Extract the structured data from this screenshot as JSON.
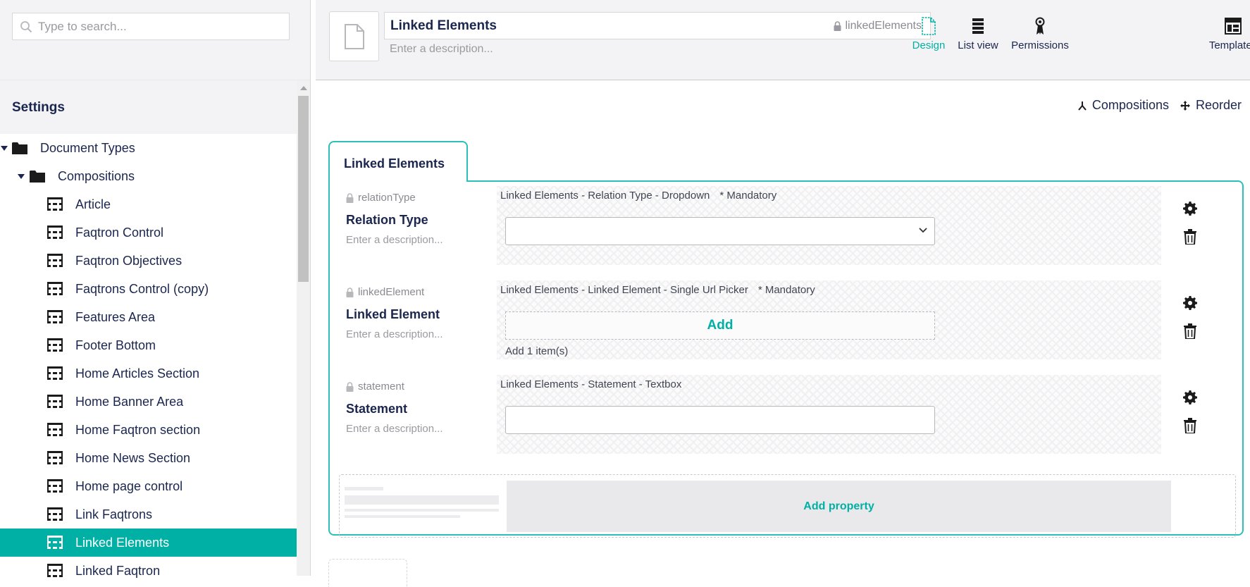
{
  "sidebar": {
    "search_placeholder": "Type to search...",
    "section_title": "Settings",
    "tree": [
      {
        "label": "Document Types",
        "type": "folder",
        "level": 0,
        "expanded": true
      },
      {
        "label": "Compositions",
        "type": "folder",
        "level": 1,
        "expanded": true
      },
      {
        "label": "Article",
        "type": "doctype",
        "level": 2
      },
      {
        "label": "Faqtron Control",
        "type": "doctype",
        "level": 2
      },
      {
        "label": "Faqtron Objectives",
        "type": "doctype",
        "level": 2
      },
      {
        "label": "Faqtrons Control (copy)",
        "type": "doctype",
        "level": 2
      },
      {
        "label": "Features Area",
        "type": "doctype",
        "level": 2
      },
      {
        "label": "Footer Bottom",
        "type": "doctype",
        "level": 2
      },
      {
        "label": "Home Articles Section",
        "type": "doctype",
        "level": 2
      },
      {
        "label": "Home Banner Area",
        "type": "doctype",
        "level": 2
      },
      {
        "label": "Home Faqtron section",
        "type": "doctype",
        "level": 2
      },
      {
        "label": "Home News Section",
        "type": "doctype",
        "level": 2
      },
      {
        "label": "Home page control",
        "type": "doctype",
        "level": 2
      },
      {
        "label": "Link Faqtrons",
        "type": "doctype",
        "level": 2
      },
      {
        "label": "Linked Elements",
        "type": "doctype",
        "level": 2,
        "selected": true
      },
      {
        "label": "Linked Faqtron",
        "type": "doctype",
        "level": 2
      }
    ]
  },
  "header": {
    "name": "Linked Elements",
    "alias": "linkedElements",
    "description_placeholder": "Enter a description...",
    "nav": [
      {
        "label": "Design",
        "icon": "document-outline-icon",
        "active": true
      },
      {
        "label": "List view",
        "icon": "list-view-icon",
        "active": false
      },
      {
        "label": "Permissions",
        "icon": "permissions-icon",
        "active": false
      },
      {
        "label": "Templates",
        "icon": "templates-icon",
        "active": false
      }
    ]
  },
  "content": {
    "actions": {
      "compositions": "Compositions",
      "reorder": "Reorder"
    },
    "group": {
      "name": "Linked Elements",
      "properties": [
        {
          "alias": "relationType",
          "label": "Relation Type",
          "description": "Enter a description...",
          "editor": "Linked Elements - Relation Type - Dropdown",
          "mandatory": "* Mandatory",
          "kind": "select"
        },
        {
          "alias": "linkedElement",
          "label": "Linked Element",
          "description": "Enter a description...",
          "editor": "Linked Elements - Linked Element - Single Url Picker",
          "mandatory": "* Mandatory",
          "kind": "add",
          "add_label": "Add",
          "add_count": "Add 1 item(s)"
        },
        {
          "alias": "statement",
          "label": "Statement",
          "description": "Enter a description...",
          "editor": "Linked Elements - Statement - Textbox",
          "mandatory": "",
          "kind": "text"
        }
      ],
      "add_property": "Add property"
    }
  },
  "colors": {
    "accent": "#00b0a4",
    "border_accent": "#2bc0b9",
    "text": "#1b264f",
    "muted": "#9a9aa0"
  }
}
